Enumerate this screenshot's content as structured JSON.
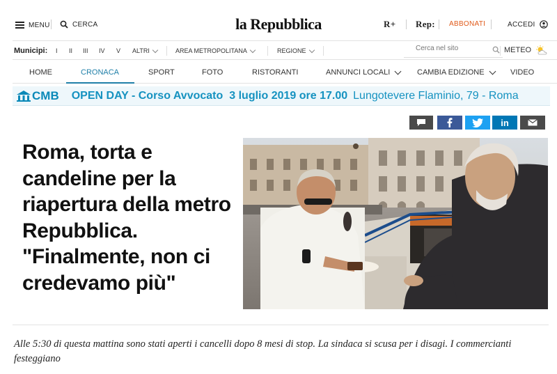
{
  "header": {
    "menu_label": "MENU",
    "search_label": "CERCA",
    "logo": "la Repubblica",
    "rplus_label": "R+",
    "rep_label": "Rep:",
    "subscribe_label": "ABBONATI",
    "login_label": "ACCEDI",
    "accent_color": "#e05a1a"
  },
  "municipi": {
    "label": "Municipi:",
    "items": [
      "I",
      "II",
      "III",
      "IV",
      "V"
    ],
    "other_label": "ALTRI",
    "metro_label": "AREA METROPOLITANA",
    "region_label": "REGIONE",
    "search_placeholder": "Cerca nel sito",
    "meteo_label": "METEO"
  },
  "nav": {
    "items": [
      {
        "label": "HOME"
      },
      {
        "label": "CRONACA",
        "active": true
      },
      {
        "label": "SPORT"
      },
      {
        "label": "FOTO"
      },
      {
        "label": "RISTORANTI"
      },
      {
        "label": "ANNUNCI LOCALI"
      },
      {
        "label": "CAMBIA EDIZIONE"
      },
      {
        "label": "VIDEO"
      }
    ]
  },
  "banner": {
    "brand": "CMB",
    "text": "OPEN DAY - Corso Avvocato",
    "date": "3 luglio 2019 ore 17.00",
    "place": "Lungotevere Flaminio, 79 - Roma",
    "color": "#1592c0"
  },
  "share": {
    "comment_icon": "comment-icon",
    "facebook_icon": "facebook-icon",
    "twitter_icon": "twitter-icon",
    "linkedin_icon": "linkedin-icon",
    "email_icon": "email-icon"
  },
  "article": {
    "headline": "Roma, torta e candeline per la riapertura della metro Repubblica. \"Finalmente, non ci credevamo più\"",
    "summary": "Alle 5:30 di questa mattina sono stati aperti i cancelli dopo 8 mesi di stop. La sindaca si scusa per i disagi. I commercianti festeggiano"
  }
}
